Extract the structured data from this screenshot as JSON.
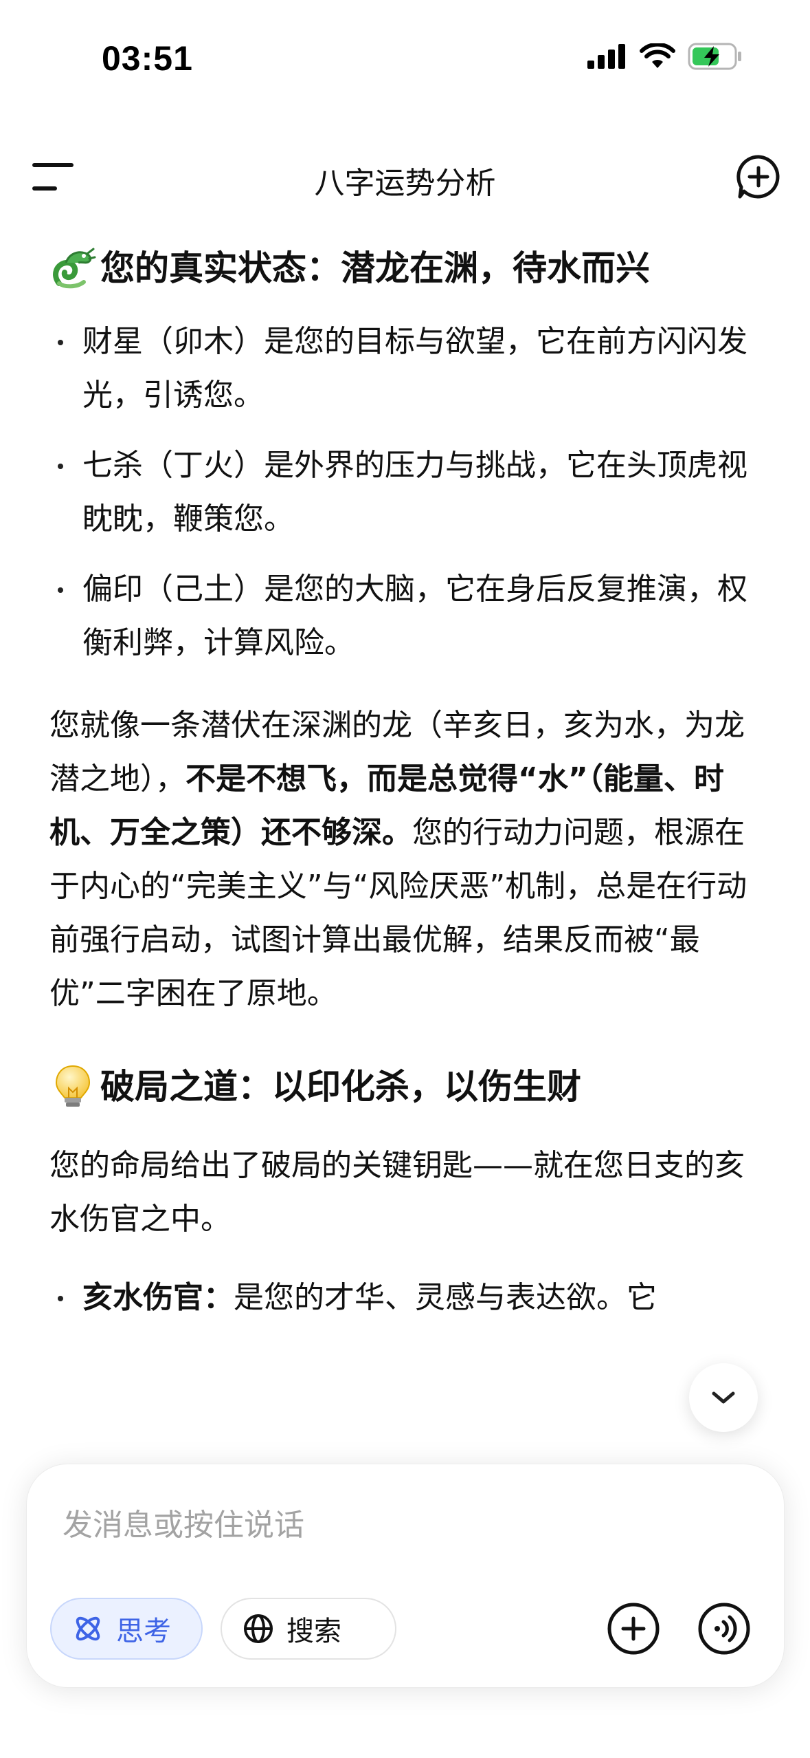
{
  "status_bar": {
    "time": "03:51"
  },
  "nav": {
    "title": "八字运势分析"
  },
  "icons": {
    "menu": "menu-icon",
    "new_chat": "new-chat-icon",
    "dragon": "dragon-emoji-icon",
    "bulb": "light-bulb-emoji-icon",
    "chevron": "chevron-down-icon",
    "atom": "atom-icon",
    "globe": "globe-icon",
    "plus": "plus-icon",
    "voice": "voice-call-icon"
  },
  "colors": {
    "accent_blue": "#3e64e6",
    "chip_bg": "#ebf1ff",
    "battery_green": "#34c759"
  },
  "content": {
    "section1": {
      "heading": "您的真实状态：潜龙在渊，待水而兴",
      "bullets": [
        "财星（卯木）是您的目标与欲望，它在前方闪闪发光，引诱您。",
        "七杀（丁火）是外界的压力与挑战，它在头顶虎视眈眈，鞭策您。",
        "偏印（己土）是您的大脑，它在身后反复推演，权衡利弊，计算风险。"
      ],
      "para_a": "您就像一条潜伏在深渊的龙（辛亥日，亥为水，为龙潜之地），",
      "para_b_bold": "不是不想飞，而是总觉得“水”（能量、时机、万全之策）还不够深。",
      "para_c": "您的行动力问题，根源在于内心的“完美主义”与“风险厌恶”机制，总是在行动前强行启动，试图计算出最优解，结果反而被“最优”二字困在了原地。"
    },
    "section2": {
      "heading": "破局之道：以印化杀，以伤生财",
      "para": "您的命局给出了破局的关键钥匙——就在您日支的亥水伤官之中。",
      "bullet_label": "亥水伤官：",
      "bullet_text": "是您的才华、灵感与表达欲。它"
    }
  },
  "composer": {
    "placeholder": "发消息或按住说话",
    "think_label": "思考",
    "search_label": "搜索"
  }
}
